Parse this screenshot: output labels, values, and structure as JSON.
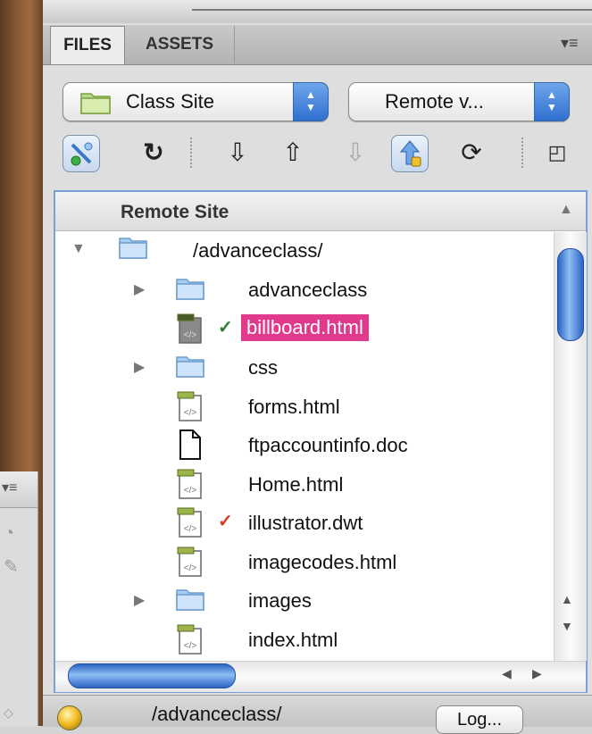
{
  "tabs": [
    {
      "label": "FILES"
    },
    {
      "label": "ASSETS"
    }
  ],
  "panel_menu_icon": "panel-options-icon",
  "site_dropdown": {
    "value": "Class Site"
  },
  "view_dropdown": {
    "value": "Remote v..."
  },
  "toolbar": {
    "icons": [
      "connect-icon",
      "refresh-icon",
      "get-icon",
      "put-icon",
      "checkout-icon",
      "checkin-icon",
      "sync-icon",
      "expand-icon"
    ]
  },
  "tree": {
    "header": "Remote Site",
    "root": "/advanceclass/",
    "items": [
      {
        "label": "advanceclass",
        "type": "folder",
        "expandable": true,
        "check": ""
      },
      {
        "label": "billboard.html",
        "type": "html-locked",
        "expandable": false,
        "check": "✓",
        "check_color": "#2e7d2e",
        "selected": true
      },
      {
        "label": "css",
        "type": "folder",
        "expandable": true,
        "check": ""
      },
      {
        "label": "forms.html",
        "type": "html",
        "expandable": false,
        "check": ""
      },
      {
        "label": "ftpaccountinfo.doc",
        "type": "doc",
        "expandable": false,
        "check": ""
      },
      {
        "label": "Home.html",
        "type": "html",
        "expandable": false,
        "check": ""
      },
      {
        "label": "illustrator.dwt",
        "type": "html",
        "expandable": false,
        "check": "✓",
        "check_color": "#d9381e"
      },
      {
        "label": "imagecodes.html",
        "type": "html",
        "expandable": false,
        "check": ""
      },
      {
        "label": "images",
        "type": "folder",
        "expandable": true,
        "check": ""
      },
      {
        "label": "index.html",
        "type": "html",
        "expandable": false,
        "check": ""
      }
    ]
  },
  "status": {
    "path": "/advanceclass/",
    "log_label": "Log..."
  },
  "colors": {
    "selection": "#e13a8d",
    "scroll_thumb": "#2b64c4"
  }
}
